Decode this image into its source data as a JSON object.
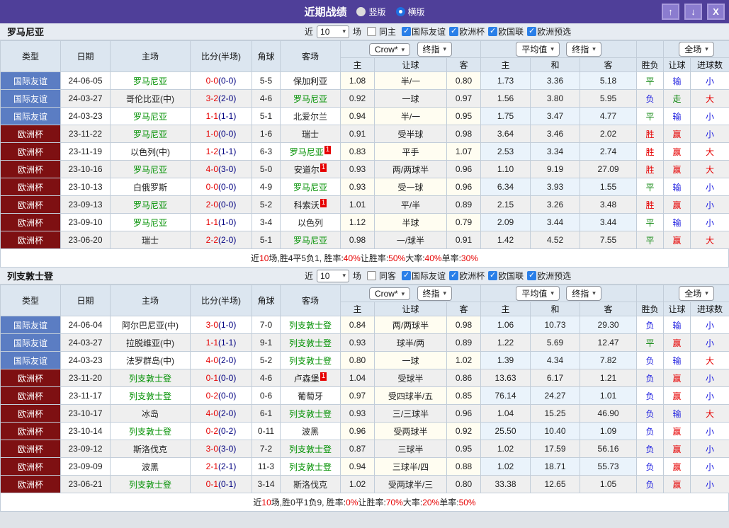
{
  "titlebar": {
    "title": "近期战绩",
    "view_options": [
      {
        "label": "竖版",
        "selected": false
      },
      {
        "label": "横版",
        "selected": true
      }
    ],
    "buttons": {
      "up": "↑",
      "down": "↓",
      "close": "X"
    }
  },
  "table_columns": {
    "type": "类型",
    "date": "日期",
    "home": "主场",
    "score": "比分(半场)",
    "corner": "角球",
    "away": "客场",
    "odds_home": "主",
    "odds_handicap": "让球",
    "odds_away": "客",
    "avg_home": "主",
    "avg_draw": "和",
    "avg_away": "客",
    "result": "胜负",
    "handicap_result": "让球",
    "goals": "进球数"
  },
  "colors": {
    "titlebar_purple": "#4f3f99",
    "type_friendly_blue": "#5b7dc3",
    "type_euro_red": "#7e1012",
    "focus_team_green": "#009000",
    "score_red": "#e60000",
    "win_red": "#e60000",
    "draw_green": "#008000",
    "lose_blue": "#2020e0"
  },
  "result_color_map": {
    "胜": "win",
    "平": "draw",
    "负": "lose",
    "赢": "win",
    "走": "draw",
    "输": "lose",
    "大": "win",
    "小": "lose"
  },
  "sections": [
    {
      "team": "罗马尼亚",
      "filter": {
        "prefix": "近",
        "count": "10",
        "suffix": "场",
        "same_label": "同主",
        "same_checked": false,
        "competitions": [
          {
            "label": "国际友谊",
            "checked": true
          },
          {
            "label": "欧洲杯",
            "checked": true
          },
          {
            "label": "欧国联",
            "checked": true
          },
          {
            "label": "欧洲预选",
            "checked": true
          }
        ]
      },
      "selectors": {
        "odds_source": "Crow*",
        "odds_time": "终指",
        "avg_source": "平均值",
        "avg_time": "终指",
        "scope": "全场"
      },
      "rows": [
        {
          "type": "国际友谊",
          "type_style": "friendly",
          "date": "24-06-05",
          "home": "罗马尼亚",
          "home_focus": true,
          "home_card": "",
          "score": "0-0",
          "half": "(0-0)",
          "corner": "5-5",
          "away": "保加利亚",
          "away_focus": false,
          "away_card": "",
          "odds": [
            "1.08",
            "半/一",
            "0.80"
          ],
          "avg": [
            "1.73",
            "3.36",
            "5.18"
          ],
          "outcome": [
            "平",
            "输",
            "小"
          ]
        },
        {
          "type": "国际友谊",
          "type_style": "friendly",
          "date": "24-03-27",
          "home": "哥伦比亚(中)",
          "home_focus": false,
          "home_card": "",
          "score": "3-2",
          "half": "(2-0)",
          "corner": "4-6",
          "away": "罗马尼亚",
          "away_focus": true,
          "away_card": "",
          "odds": [
            "0.92",
            "一球",
            "0.97"
          ],
          "avg": [
            "1.56",
            "3.80",
            "5.95"
          ],
          "outcome": [
            "负",
            "走",
            "大"
          ]
        },
        {
          "type": "国际友谊",
          "type_style": "friendly",
          "date": "24-03-23",
          "home": "罗马尼亚",
          "home_focus": true,
          "home_card": "",
          "score": "1-1",
          "half": "(1-1)",
          "corner": "5-1",
          "away": "北爱尔兰",
          "away_focus": false,
          "away_card": "",
          "odds": [
            "0.94",
            "半/一",
            "0.95"
          ],
          "avg": [
            "1.75",
            "3.47",
            "4.77"
          ],
          "outcome": [
            "平",
            "输",
            "小"
          ]
        },
        {
          "type": "欧洲杯",
          "type_style": "euro",
          "date": "23-11-22",
          "home": "罗马尼亚",
          "home_focus": true,
          "home_card": "",
          "score": "1-0",
          "half": "(0-0)",
          "corner": "1-6",
          "away": "瑞士",
          "away_focus": false,
          "away_card": "",
          "odds": [
            "0.91",
            "受半球",
            "0.98"
          ],
          "avg": [
            "3.64",
            "3.46",
            "2.02"
          ],
          "outcome": [
            "胜",
            "赢",
            "小"
          ]
        },
        {
          "type": "欧洲杯",
          "type_style": "euro",
          "date": "23-11-19",
          "home": "以色列(中)",
          "home_focus": false,
          "home_card": "",
          "score": "1-2",
          "half": "(1-1)",
          "corner": "6-3",
          "away": "罗马尼亚",
          "away_focus": true,
          "away_card": "1",
          "odds": [
            "0.83",
            "平手",
            "1.07"
          ],
          "avg": [
            "2.53",
            "3.34",
            "2.74"
          ],
          "outcome": [
            "胜",
            "赢",
            "大"
          ]
        },
        {
          "type": "欧洲杯",
          "type_style": "euro",
          "date": "23-10-16",
          "home": "罗马尼亚",
          "home_focus": true,
          "home_card": "",
          "score": "4-0",
          "half": "(3-0)",
          "corner": "5-0",
          "away": "安道尔",
          "away_focus": false,
          "away_card": "1",
          "odds": [
            "0.93",
            "两/两球半",
            "0.96"
          ],
          "avg": [
            "1.10",
            "9.19",
            "27.09"
          ],
          "outcome": [
            "胜",
            "赢",
            "大"
          ]
        },
        {
          "type": "欧洲杯",
          "type_style": "euro",
          "date": "23-10-13",
          "home": "白俄罗斯",
          "home_focus": false,
          "home_card": "",
          "score": "0-0",
          "half": "(0-0)",
          "corner": "4-9",
          "away": "罗马尼亚",
          "away_focus": true,
          "away_card": "",
          "odds": [
            "0.93",
            "受一球",
            "0.96"
          ],
          "avg": [
            "6.34",
            "3.93",
            "1.55"
          ],
          "outcome": [
            "平",
            "输",
            "小"
          ]
        },
        {
          "type": "欧洲杯",
          "type_style": "euro",
          "date": "23-09-13",
          "home": "罗马尼亚",
          "home_focus": true,
          "home_card": "",
          "score": "2-0",
          "half": "(0-0)",
          "corner": "5-2",
          "away": "科索沃",
          "away_focus": false,
          "away_card": "1",
          "odds": [
            "1.01",
            "平/半",
            "0.89"
          ],
          "avg": [
            "2.15",
            "3.26",
            "3.48"
          ],
          "outcome": [
            "胜",
            "赢",
            "小"
          ]
        },
        {
          "type": "欧洲杯",
          "type_style": "euro",
          "date": "23-09-10",
          "home": "罗马尼亚",
          "home_focus": true,
          "home_card": "",
          "score": "1-1",
          "half": "(1-0)",
          "corner": "3-4",
          "away": "以色列",
          "away_focus": false,
          "away_card": "",
          "odds": [
            "1.12",
            "半球",
            "0.79"
          ],
          "avg": [
            "2.09",
            "3.44",
            "3.44"
          ],
          "outcome": [
            "平",
            "输",
            "小"
          ]
        },
        {
          "type": "欧洲杯",
          "type_style": "euro",
          "date": "23-06-20",
          "home": "瑞士",
          "home_focus": false,
          "home_card": "",
          "score": "2-2",
          "half": "(2-0)",
          "corner": "5-1",
          "away": "罗马尼亚",
          "away_focus": true,
          "away_card": "",
          "odds": [
            "0.98",
            "一/球半",
            "0.91"
          ],
          "avg": [
            "1.42",
            "4.52",
            "7.55"
          ],
          "outcome": [
            "平",
            "赢",
            "大"
          ]
        }
      ],
      "summary": [
        [
          "近",
          "k"
        ],
        [
          "10",
          "r"
        ],
        [
          "场,胜4平5负1, 胜率:",
          "k"
        ],
        [
          "40%",
          "r"
        ],
        [
          " 让胜率:",
          "k"
        ],
        [
          "50%",
          "r"
        ],
        [
          " 大率:",
          "k"
        ],
        [
          "40%",
          "r"
        ],
        [
          " 单率:",
          "k"
        ],
        [
          "30%",
          "r"
        ]
      ]
    },
    {
      "team": "列支敦士登",
      "filter": {
        "prefix": "近",
        "count": "10",
        "suffix": "场",
        "same_label": "同客",
        "same_checked": false,
        "competitions": [
          {
            "label": "国际友谊",
            "checked": true
          },
          {
            "label": "欧洲杯",
            "checked": true
          },
          {
            "label": "欧国联",
            "checked": true
          },
          {
            "label": "欧洲预选",
            "checked": true
          }
        ]
      },
      "selectors": {
        "odds_source": "Crow*",
        "odds_time": "终指",
        "avg_source": "平均值",
        "avg_time": "终指",
        "scope": "全场"
      },
      "rows": [
        {
          "type": "国际友谊",
          "type_style": "friendly",
          "date": "24-06-04",
          "home": "阿尔巴尼亚(中)",
          "home_focus": false,
          "home_card": "",
          "score": "3-0",
          "half": "(1-0)",
          "corner": "7-0",
          "away": "列支敦士登",
          "away_focus": true,
          "away_card": "",
          "odds": [
            "0.84",
            "两/两球半",
            "0.98"
          ],
          "avg": [
            "1.06",
            "10.73",
            "29.30"
          ],
          "outcome": [
            "负",
            "输",
            "小"
          ]
        },
        {
          "type": "国际友谊",
          "type_style": "friendly",
          "date": "24-03-27",
          "home": "拉脱维亚(中)",
          "home_focus": false,
          "home_card": "",
          "score": "1-1",
          "half": "(1-1)",
          "corner": "9-1",
          "away": "列支敦士登",
          "away_focus": true,
          "away_card": "",
          "odds": [
            "0.93",
            "球半/两",
            "0.89"
          ],
          "avg": [
            "1.22",
            "5.69",
            "12.47"
          ],
          "outcome": [
            "平",
            "赢",
            "小"
          ]
        },
        {
          "type": "国际友谊",
          "type_style": "friendly",
          "date": "24-03-23",
          "home": "法罗群岛(中)",
          "home_focus": false,
          "home_card": "",
          "score": "4-0",
          "half": "(2-0)",
          "corner": "5-2",
          "away": "列支敦士登",
          "away_focus": true,
          "away_card": "",
          "odds": [
            "0.80",
            "一球",
            "1.02"
          ],
          "avg": [
            "1.39",
            "4.34",
            "7.82"
          ],
          "outcome": [
            "负",
            "输",
            "大"
          ]
        },
        {
          "type": "欧洲杯",
          "type_style": "euro",
          "date": "23-11-20",
          "home": "列支敦士登",
          "home_focus": true,
          "home_card": "",
          "score": "0-1",
          "half": "(0-0)",
          "corner": "4-6",
          "away": "卢森堡",
          "away_focus": false,
          "away_card": "1",
          "odds": [
            "1.04",
            "受球半",
            "0.86"
          ],
          "avg": [
            "13.63",
            "6.17",
            "1.21"
          ],
          "outcome": [
            "负",
            "赢",
            "小"
          ]
        },
        {
          "type": "欧洲杯",
          "type_style": "euro",
          "date": "23-11-17",
          "home": "列支敦士登",
          "home_focus": true,
          "home_card": "",
          "score": "0-2",
          "half": "(0-0)",
          "corner": "0-6",
          "away": "葡萄牙",
          "away_focus": false,
          "away_card": "",
          "odds": [
            "0.97",
            "受四球半/五",
            "0.85"
          ],
          "avg": [
            "76.14",
            "24.27",
            "1.01"
          ],
          "outcome": [
            "负",
            "赢",
            "小"
          ]
        },
        {
          "type": "欧洲杯",
          "type_style": "euro",
          "date": "23-10-17",
          "home": "冰岛",
          "home_focus": false,
          "home_card": "",
          "score": "4-0",
          "half": "(2-0)",
          "corner": "6-1",
          "away": "列支敦士登",
          "away_focus": true,
          "away_card": "",
          "odds": [
            "0.93",
            "三/三球半",
            "0.96"
          ],
          "avg": [
            "1.04",
            "15.25",
            "46.90"
          ],
          "outcome": [
            "负",
            "输",
            "大"
          ]
        },
        {
          "type": "欧洲杯",
          "type_style": "euro",
          "date": "23-10-14",
          "home": "列支敦士登",
          "home_focus": true,
          "home_card": "",
          "score": "0-2",
          "half": "(0-2)",
          "corner": "0-11",
          "away": "波黑",
          "away_focus": false,
          "away_card": "",
          "odds": [
            "0.96",
            "受两球半",
            "0.92"
          ],
          "avg": [
            "25.50",
            "10.40",
            "1.09"
          ],
          "outcome": [
            "负",
            "赢",
            "小"
          ]
        },
        {
          "type": "欧洲杯",
          "type_style": "euro",
          "date": "23-09-12",
          "home": "斯洛伐克",
          "home_focus": false,
          "home_card": "",
          "score": "3-0",
          "half": "(3-0)",
          "corner": "7-2",
          "away": "列支敦士登",
          "away_focus": true,
          "away_card": "",
          "odds": [
            "0.87",
            "三球半",
            "0.95"
          ],
          "avg": [
            "1.02",
            "17.59",
            "56.16"
          ],
          "outcome": [
            "负",
            "赢",
            "小"
          ]
        },
        {
          "type": "欧洲杯",
          "type_style": "euro",
          "date": "23-09-09",
          "home": "波黑",
          "home_focus": false,
          "home_card": "",
          "score": "2-1",
          "half": "(2-1)",
          "corner": "11-3",
          "away": "列支敦士登",
          "away_focus": true,
          "away_card": "",
          "odds": [
            "0.94",
            "三球半/四",
            "0.88"
          ],
          "avg": [
            "1.02",
            "18.71",
            "55.73"
          ],
          "outcome": [
            "负",
            "赢",
            "小"
          ]
        },
        {
          "type": "欧洲杯",
          "type_style": "euro",
          "date": "23-06-21",
          "home": "列支敦士登",
          "home_focus": true,
          "home_card": "",
          "score": "0-1",
          "half": "(0-1)",
          "corner": "3-14",
          "away": "斯洛伐克",
          "away_focus": false,
          "away_card": "",
          "odds": [
            "1.02",
            "受两球半/三",
            "0.80"
          ],
          "avg": [
            "33.38",
            "12.65",
            "1.05"
          ],
          "outcome": [
            "负",
            "赢",
            "小"
          ]
        }
      ],
      "summary": [
        [
          "近",
          "k"
        ],
        [
          "10",
          "r"
        ],
        [
          "场,胜0平1负9, 胜率:",
          "k"
        ],
        [
          "0%",
          "r"
        ],
        [
          " 让胜率:",
          "k"
        ],
        [
          "70%",
          "r"
        ],
        [
          " 大率:",
          "k"
        ],
        [
          "20%",
          "r"
        ],
        [
          " 单率:",
          "k"
        ],
        [
          "50%",
          "r"
        ]
      ]
    }
  ]
}
